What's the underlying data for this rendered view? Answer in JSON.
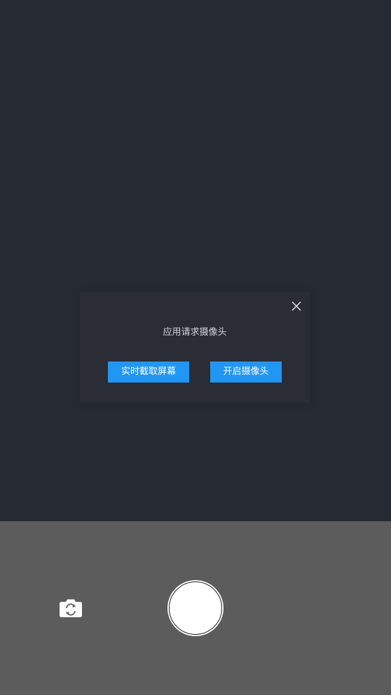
{
  "dialog": {
    "message": "应用请求摄像头",
    "buttons": {
      "screen_capture": "实时截取屏幕",
      "open_camera": "开启摄像头"
    }
  },
  "icons": {
    "close": "close-icon",
    "switch_camera": "switch-camera-icon",
    "shutter": "shutter-button"
  },
  "colors": {
    "viewfinder_bg": "#262b33",
    "dialog_bg": "#2a2d35",
    "button_primary": "#2196f3",
    "controls_bg": "#5c5c5c"
  }
}
